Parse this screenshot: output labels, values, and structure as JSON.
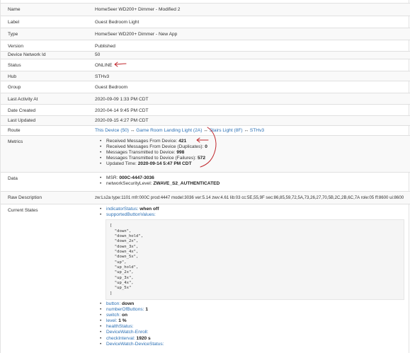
{
  "fields": {
    "name": {
      "label": "Name",
      "value": "HomeSeer WD200+ Dimmer - Modified 2"
    },
    "label": {
      "label": "Label",
      "value": "Guest Bedroom Light"
    },
    "type": {
      "label": "Type",
      "value": "HomeSeer WD200+ Dimmer - New App"
    },
    "version": {
      "label": "Version",
      "value": "Published"
    },
    "network_id": {
      "label": "Device Network Id",
      "value": "50"
    },
    "status": {
      "label": "Status",
      "value": "ONLINE"
    },
    "hub": {
      "label": "Hub",
      "value": "STHv3"
    },
    "group": {
      "label": "Group",
      "value": "Guest Bedroom"
    },
    "last_activity": {
      "label": "Last Activity At",
      "value": "2020-09-09 1:33 PM CDT"
    },
    "date_created": {
      "label": "Date Created",
      "value": "2020-04-14 9:45 PM CDT"
    },
    "last_updated": {
      "label": "Last Updated",
      "value": "2020-09-15 4:27 PM CDT"
    },
    "route": {
      "label": "Route",
      "hops": [
        "This Device (50)",
        "Game Room Landing Light (2A)",
        "Stairs Light (8F)",
        "STHv3"
      ],
      "separator": "↔"
    },
    "metrics": {
      "label": "Metrics",
      "items": [
        {
          "name": "Received Messages From Device:",
          "value": "421"
        },
        {
          "name": "Received Messages From Device (Duplicates):",
          "value": "0"
        },
        {
          "name": "Messages Transmitted to Device:",
          "value": "998"
        },
        {
          "name": "Messages Transmitted to Device (Failures):",
          "value": "572"
        },
        {
          "name": "Updated Time:",
          "value": "2020-09-14 5:47 PM CDT"
        }
      ]
    },
    "data": {
      "label": "Data",
      "items": [
        {
          "name": "MSR:",
          "value": "000C-4447-3036"
        },
        {
          "name": "networkSecurityLevel:",
          "value": "ZWAVE_S2_AUTHENTICATED"
        }
      ]
    },
    "raw": {
      "label": "Raw Description",
      "value": "zw:Ls2a type:1101 mfr:000C prod:4447 model:3036 ver:5.14 zwv:4.61 lib:03 cc:5E,55,9F sec:86,85,59,72,5A,73,26,27,70,5B,2C,2B,6C,7A role:05 ff:8600 ui:8600"
    },
    "current_states": {
      "label": "Current States",
      "top": [
        {
          "name": "indicatorStatus:",
          "value": "when off"
        },
        {
          "name": "supportedButtonValues:",
          "value": ""
        }
      ],
      "code_lines": [
        "[",
        "  \"down\",",
        "  \"down_hold\",",
        "  \"down_2x\",",
        "  \"down_3x\",",
        "  \"down_4x\",",
        "  \"down_5x\",",
        "  \"up\",",
        "  \"up_hold\",",
        "  \"up_2x\",",
        "  \"up_3x\",",
        "  \"up_4x\",",
        "  \"up_5x\"",
        "]"
      ],
      "bottom": [
        {
          "name": "button:",
          "value": "down"
        },
        {
          "name": "numberOfButtons:",
          "value": "1"
        },
        {
          "name": "switch:",
          "value": "on"
        },
        {
          "name": "level:",
          "value": "1 %"
        },
        {
          "name": "healthStatus:",
          "value": ""
        },
        {
          "name": "DeviceWatch-Enroll:",
          "value": ""
        },
        {
          "name": "checkInterval:",
          "value": "1920 s"
        },
        {
          "name": "DeviceWatch-DeviceStatus:",
          "value": ""
        }
      ]
    }
  },
  "colors": {
    "link": "#2a6fb4",
    "annotation": "#c0262b",
    "alt_row": "#f9f9f9"
  }
}
